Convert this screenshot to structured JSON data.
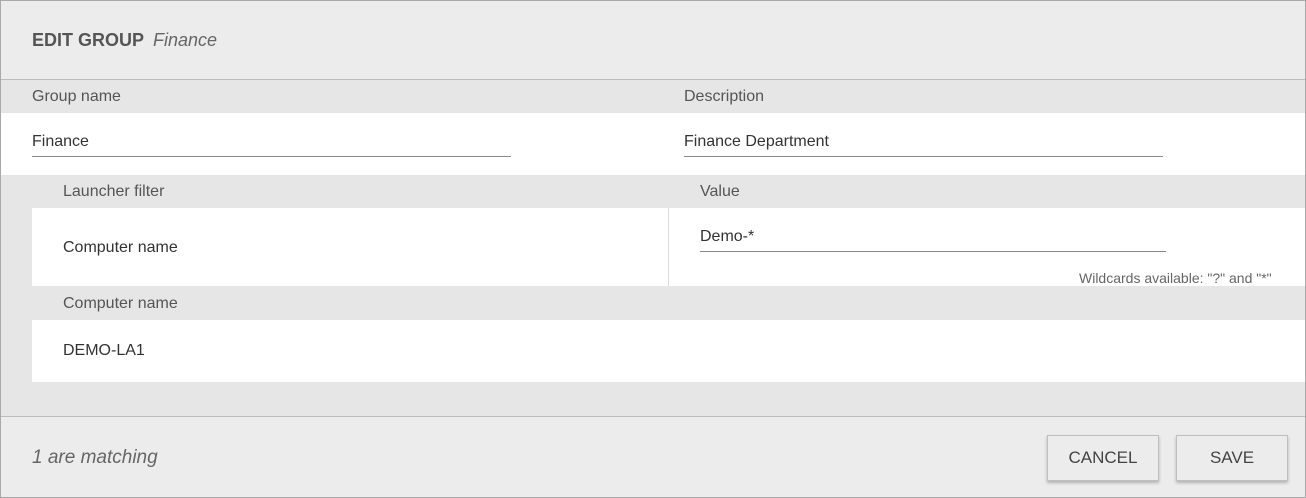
{
  "header": {
    "title": "EDIT GROUP",
    "subtitle": "Finance"
  },
  "group_name": {
    "label": "Group name",
    "value": "Finance"
  },
  "description": {
    "label": "Description",
    "value": "Finance Department"
  },
  "filter": {
    "launcher_filter_label": "Launcher filter",
    "value_label": "Value",
    "filter_type": "Computer name",
    "filter_value": "Demo-*",
    "hint": "Wildcards available: \"?\" and \"*\""
  },
  "results": {
    "column_label": "Computer name",
    "rows": [
      "DEMO-LA1"
    ]
  },
  "footer": {
    "matching_text": "1 are matching",
    "cancel_label": "CANCEL",
    "save_label": "SAVE"
  }
}
